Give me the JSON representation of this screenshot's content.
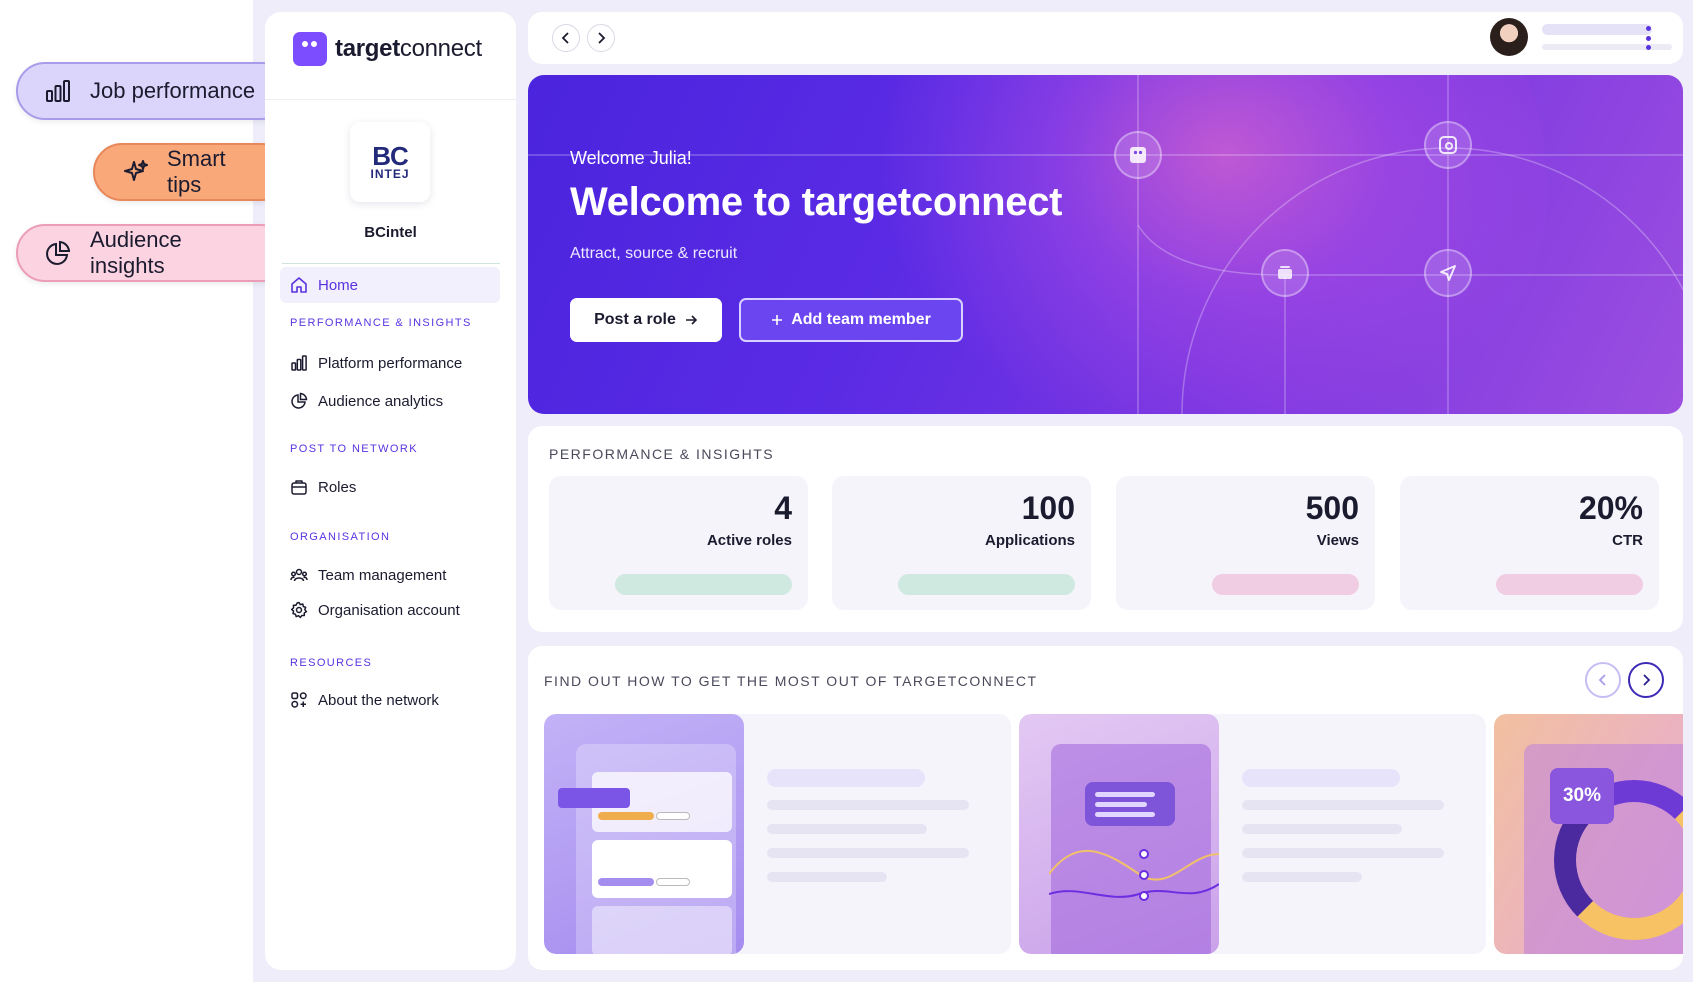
{
  "pills": {
    "job": "Job performance",
    "tips": "Smart tips",
    "audience": "Audience insights"
  },
  "sidebar": {
    "brand_bold": "target",
    "brand_light": "connect",
    "org_logo_line1": "BC",
    "org_logo_line2": "INTEJ",
    "org_name": "BCintel",
    "home": "Home",
    "sections": {
      "perf": "PERFORMANCE & INSIGHTS",
      "post": "POST TO NETWORK",
      "org": "ORGANISATION",
      "resources": "RESOURCES"
    },
    "items": {
      "platform": "Platform performance",
      "audience": "Audience analytics",
      "roles": "Roles",
      "team": "Team management",
      "account": "Organisation account",
      "about": "About the network"
    }
  },
  "hero": {
    "greeting": "Welcome Julia!",
    "title": "Welcome to targetconnect",
    "subtitle": "Attract, source & recruit",
    "post_button": "Post a role",
    "add_button": "Add team member"
  },
  "performance": {
    "title": "PERFORMANCE & INSIGHTS",
    "stats": [
      {
        "value": "4",
        "label": "Active roles"
      },
      {
        "value": "100",
        "label": "Applications"
      },
      {
        "value": "500",
        "label": "Views"
      },
      {
        "value": "20%",
        "label": "CTR"
      }
    ]
  },
  "resources": {
    "title": "FIND OUT HOW TO GET THE MOST OUT OF TARGETCONNECT",
    "card3_badge": "30%"
  },
  "colors": {
    "accent": "#5a33e0",
    "hero_start": "#4b24de",
    "hero_end": "#9c4fe0",
    "bar_green": "#cfe8e0",
    "bar_pink": "#f1cde4"
  }
}
